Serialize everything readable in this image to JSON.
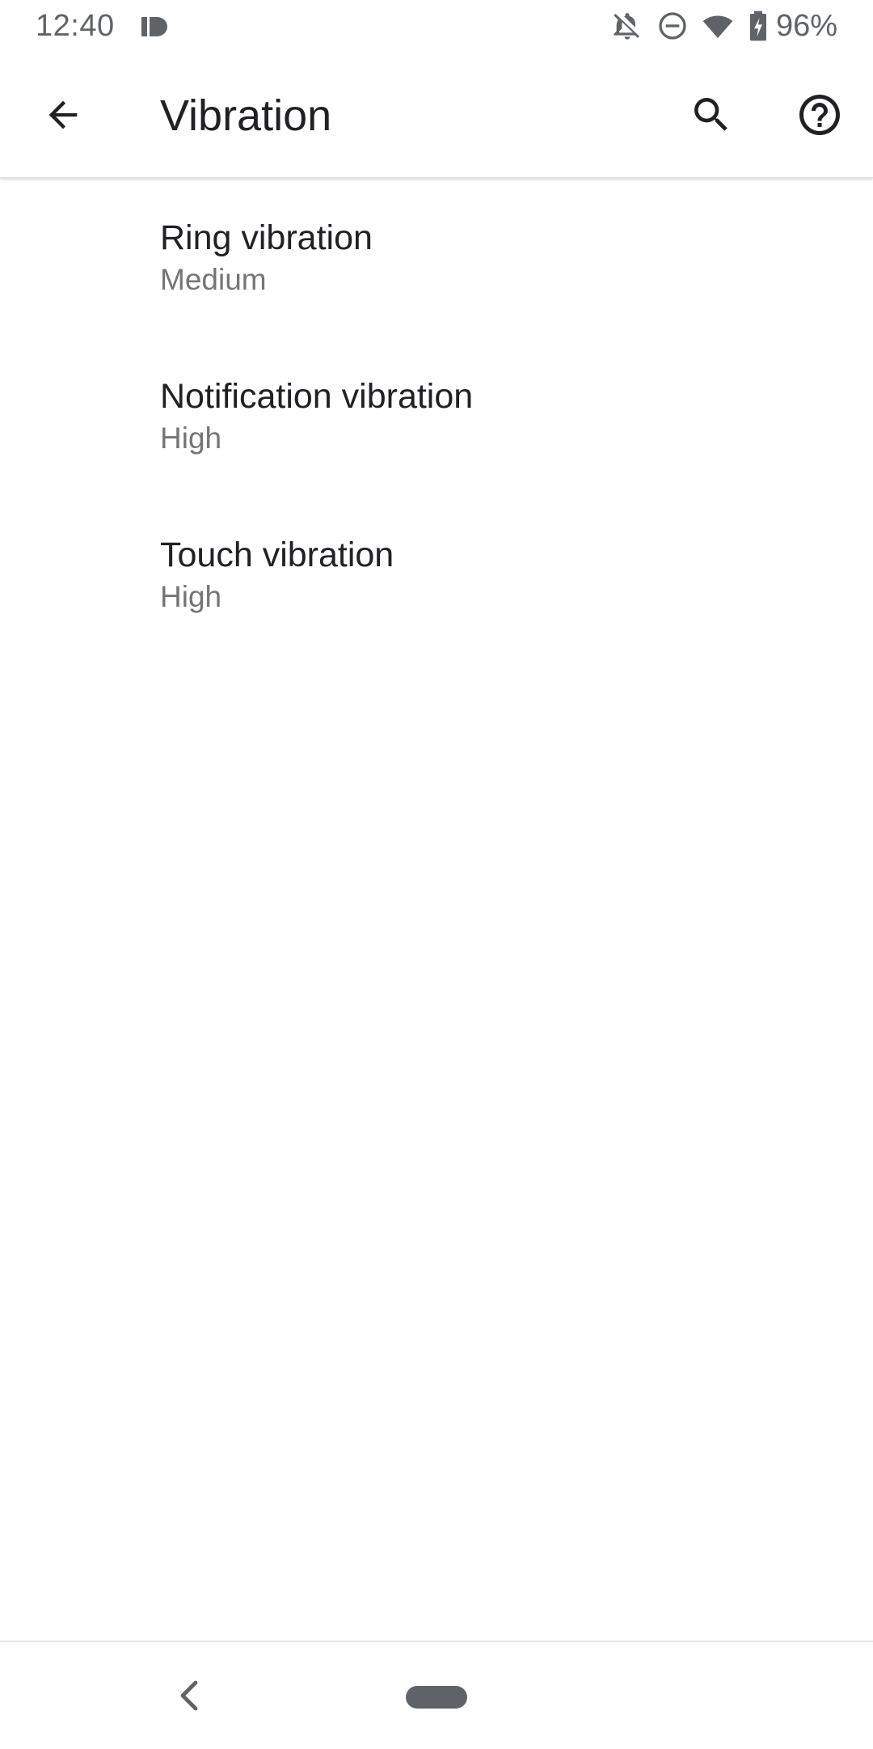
{
  "status_bar": {
    "time": "12:40",
    "battery_percent": "96%",
    "icons": [
      "id-icon",
      "notifications-off-icon",
      "do-not-disturb-icon",
      "wifi-icon",
      "battery-charging-icon"
    ]
  },
  "app_bar": {
    "title": "Vibration",
    "icons": [
      "back-arrow-icon",
      "search-icon",
      "help-icon"
    ]
  },
  "settings": {
    "items": [
      {
        "title": "Ring vibration",
        "summary": "Medium"
      },
      {
        "title": "Notification vibration",
        "summary": "High"
      },
      {
        "title": "Touch vibration",
        "summary": "High"
      }
    ]
  },
  "nav_bar": {
    "icons": [
      "nav-back-icon",
      "home-pill-icon"
    ]
  },
  "colors": {
    "text_primary": "#202124",
    "text_secondary": "#757575",
    "icon": "#5f6368",
    "background": "#ffffff"
  }
}
